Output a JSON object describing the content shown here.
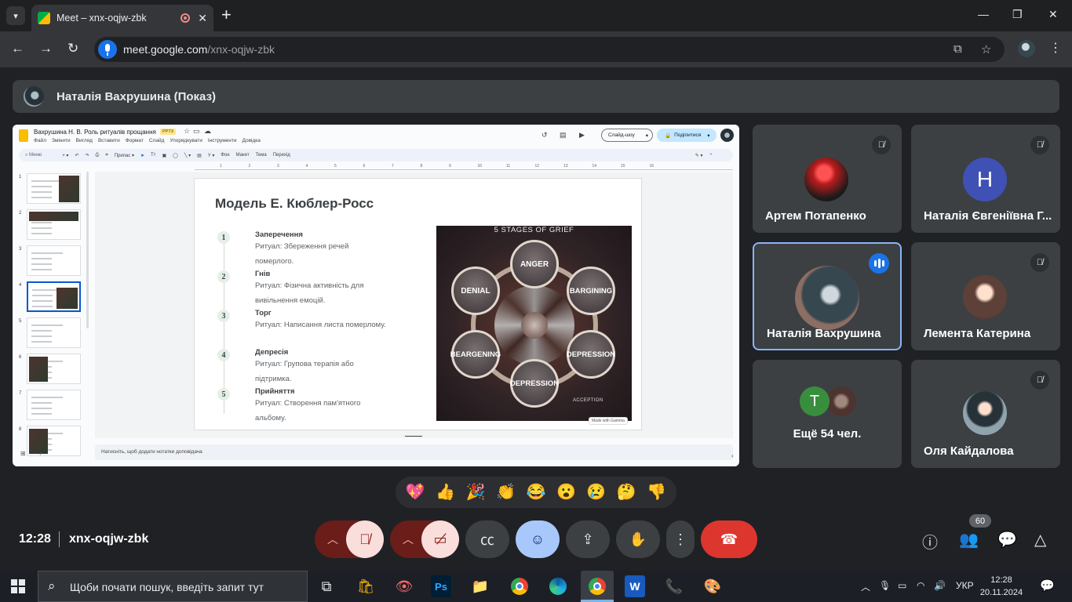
{
  "browser": {
    "tab_title": "Meet – xnx-oqjw-zbk",
    "url_host": "meet.google.com",
    "url_path": "/xnx-oqjw-zbk"
  },
  "banner": {
    "presenter": "Наталія Вахрушина (Показ)"
  },
  "slides_app": {
    "doc_title": "Вахрушина Н. В. Роль ритуалів прощання",
    "format_badge": "PPTX",
    "menu": [
      "Файл",
      "Змінити",
      "Вигляд",
      "Вставити",
      "Формат",
      "Слайд",
      "Упорядкувати",
      "Інструменти",
      "Довідка"
    ],
    "slideshow_label": "Слайд-шоу",
    "share_label": "Поділитися",
    "toolbar": {
      "menu_search": "Меню",
      "fit": "Припас",
      "background": "Фон",
      "layout": "Макет",
      "theme": "Тема",
      "transition": "Перехід"
    },
    "ruler_numbers": [
      "1",
      "2",
      "3",
      "4",
      "5",
      "6",
      "7",
      "8",
      "9",
      "10",
      "11",
      "12",
      "13",
      "14",
      "15",
      "16"
    ],
    "thumbnail_numbers": [
      "1",
      "2",
      "3",
      "4",
      "5",
      "6",
      "7",
      "8"
    ],
    "selected_slide": 4,
    "notes_placeholder": "Натисніть, щоб додати нотатки доповідача"
  },
  "slide": {
    "title": "Модель Е. Кюблер-Росс",
    "stages": [
      {
        "num": "1",
        "heading": "Заперечення",
        "text": "Ритуал: Збереження речей померлого."
      },
      {
        "num": "2",
        "heading": "Гнів",
        "text": "Ритуал: Фізична активність для вивільнення емоцій."
      },
      {
        "num": "3",
        "heading": "Торг",
        "text": "Ритуал: Написання листа померлому."
      },
      {
        "num": "4",
        "heading": "Депресія",
        "text": "Ритуал: Групова терапія або підтримка."
      },
      {
        "num": "5",
        "heading": "Прийняття",
        "text": "Ритуал: Створення пам'ятного альбому."
      }
    ],
    "image": {
      "title": "5 STAGES OF GRIEF",
      "labels": {
        "anger": "ANGER",
        "denial": "DENIAL",
        "bargining": "BARGINING",
        "beargening": "BEARGENING",
        "depression_right": "DEPRESSION",
        "depression_bottom": "DEPRESSION"
      },
      "footer": "ACCEPTION",
      "watermark": "Made with Gamma"
    }
  },
  "participants": [
    {
      "name": "Артем Потапенко",
      "muted": true,
      "avatar_color": "#c62828"
    },
    {
      "name": "Наталія Євгеніївна Г...",
      "muted": true,
      "initial": "Н",
      "avatar_color": "#3f51b5"
    },
    {
      "name": "Наталія Вахрушина",
      "muted": false,
      "speaking": true,
      "avatar_color": "#455a64"
    },
    {
      "name": "Лемента Катерина",
      "muted": true,
      "avatar_color": "#6d4c41"
    },
    {
      "name": "Ещё 54 чел.",
      "initial": "T",
      "avatar_color": "#388e3c"
    },
    {
      "name": "Оля Кайдалова",
      "muted": true,
      "avatar_color": "#78909c"
    }
  ],
  "reactions": [
    "💖",
    "👍",
    "🎉",
    "👏",
    "😂",
    "😮",
    "😢",
    "🤔",
    "👎"
  ],
  "meeting": {
    "time": "12:28",
    "code": "xnx-oqjw-zbk",
    "participant_count": "60"
  },
  "taskbar": {
    "search_placeholder": "Щоби почати пошук, введіть запит тут",
    "language": "УКР",
    "time": "12:28",
    "date": "20.11.2024"
  },
  "colors": {
    "meet_bg": "#202124",
    "tile_bg": "#3c4043",
    "end_call": "#dc362e",
    "active_blue": "#1a73e8",
    "muted_red": "#f9dedc"
  }
}
